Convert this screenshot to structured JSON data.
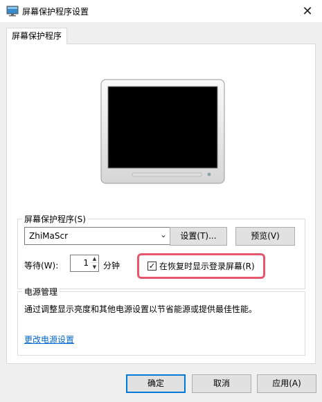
{
  "window": {
    "title": "屏幕保护程序设置",
    "close_glyph": "✕"
  },
  "tabs": [
    {
      "label": "屏幕保护程序"
    }
  ],
  "screensaver": {
    "group_label": "屏幕保护程序(S)",
    "selected": "ZhiMaScr",
    "settings_button": "设置(T)...",
    "preview_button": "预览(V)",
    "wait_label": "等待(W):",
    "wait_value": "1",
    "wait_unit": "分钟",
    "logon_checkbox": {
      "label": "在恢复时显示登录屏幕(R)",
      "checked": true,
      "mark": "✓"
    }
  },
  "power": {
    "group_label": "电源管理",
    "description": "通过调整显示亮度和其他电源设置以节省能源或提供最佳性能。",
    "link": "更改电源设置"
  },
  "footer": {
    "ok": "确定",
    "cancel": "取消",
    "apply": "应用(A)"
  },
  "icons": {
    "app": "display-settings-icon",
    "close": "close-icon",
    "dropdown": "chevron-down-icon"
  },
  "colors": {
    "highlight": "#e8566e",
    "link": "#0066cc",
    "default_button_border": "#0078d7"
  }
}
